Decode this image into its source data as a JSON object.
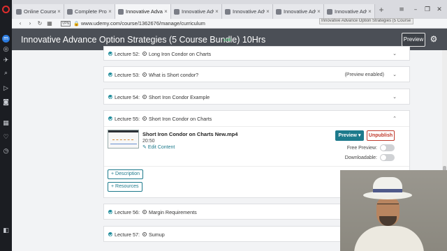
{
  "browser": {
    "tabs": [
      {
        "label": "Online Courses - Ar",
        "active": false
      },
      {
        "label": "Complete Pro & Ad",
        "active": false
      },
      {
        "label": "Innovative Advanc",
        "active": true
      },
      {
        "label": "Innovative Advanc",
        "active": false
      },
      {
        "label": "Innovative Advanc",
        "active": false
      },
      {
        "label": "Innovative Advanc",
        "active": false
      },
      {
        "label": "Innovative Advanc",
        "active": false
      }
    ],
    "new_tab": "+",
    "tooltip": "Innovative Advance Option Strategies (5 Course",
    "vpn": "VPN",
    "url": "www.udemy.com/course/1362676/manage/curriculum"
  },
  "header": {
    "course_title": "Innovative Advance Option Strategies (5 Course Bundle) 10Hrs",
    "live_badge": "LIVE",
    "preview_label": "Preview"
  },
  "lectures": [
    {
      "number": "Lecture 52:",
      "title": "Long Iron Condor on Charts",
      "preview_enabled": ""
    },
    {
      "number": "Lecture 53:",
      "title": "What is Short condor?",
      "preview_enabled": "(Preview enabled)"
    },
    {
      "number": "Lecture 54:",
      "title": "Short Iron Condor Example",
      "preview_enabled": ""
    },
    {
      "number": "Lecture 55:",
      "title": "Short Iron Condor on Charts",
      "preview_enabled": ""
    },
    {
      "number": "Lecture 56:",
      "title": "Margin Requirements",
      "preview_enabled": ""
    },
    {
      "number": "Lecture 57:",
      "title": "Sumup",
      "preview_enabled": ""
    }
  ],
  "expanded": {
    "file_name": "Short Iron Condor on Charts New.mp4",
    "duration": "20:50",
    "edit_link": "Edit Content",
    "preview_dropdown": "Preview",
    "unpublish": "Unpublish",
    "free_preview_label": "Free Preview:",
    "downloadable_label": "Downloadable:",
    "free_preview": false,
    "downloadable": false,
    "description_btn": "Description",
    "resources_btn": "Resources"
  },
  "colors": {
    "teal": "#1d7a8c",
    "header_bg": "#4b4f56",
    "unpublish_red": "#c0392b",
    "live_green": "#52c77a"
  }
}
